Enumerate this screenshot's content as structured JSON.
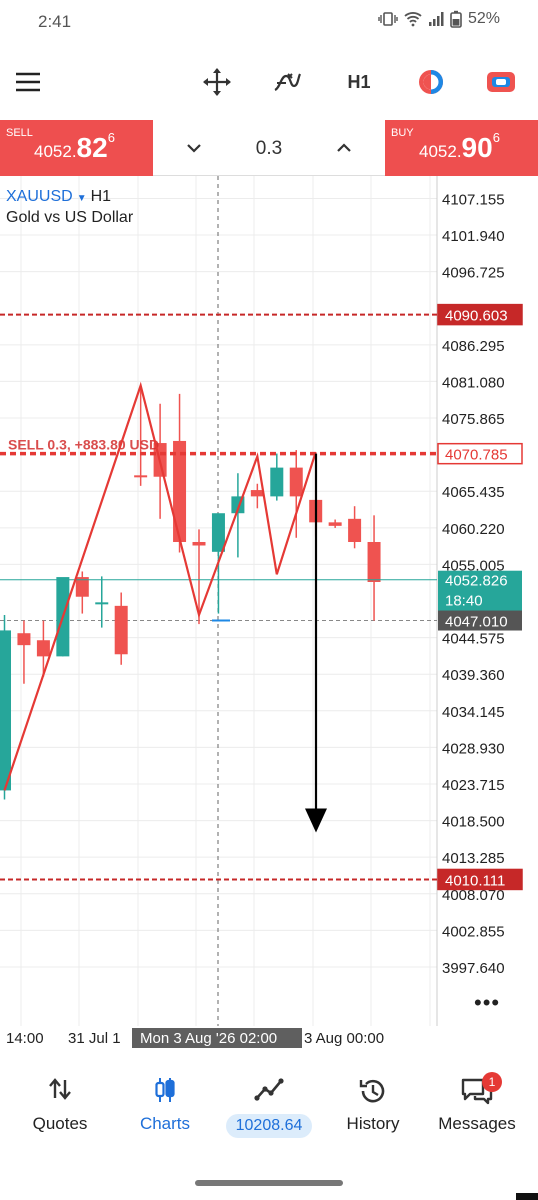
{
  "status": {
    "time": "2:41",
    "battery": "52%"
  },
  "toolbar": {
    "timeframe": "H1",
    "icons": [
      "menu-icon",
      "crosshair-icon",
      "indicator-icon",
      "timeframe",
      "color-icon",
      "oneclick-icon"
    ]
  },
  "trade": {
    "sell_label": "SELL",
    "sell_price_small": "4052.",
    "sell_price_big": "82",
    "sell_price_sup": "6",
    "buy_label": "BUY",
    "buy_price_small": "4052.",
    "buy_price_big": "90",
    "buy_price_sup": "6",
    "lot": "0.3"
  },
  "chart_header": {
    "symbol": "XAUUSD",
    "timeframe": "H1",
    "description": "Gold vs US Dollar"
  },
  "chart_data": {
    "type": "candlestick",
    "symbol": "XAUUSD",
    "timeframe": "H1",
    "ylim": [
      3994.5,
      4109.5
    ],
    "y_ticks": [
      4107.155,
      4101.94,
      4096.725,
      4086.295,
      4081.08,
      4075.865,
      4065.435,
      4060.22,
      4055.005,
      4044.575,
      4039.36,
      4034.145,
      4028.93,
      4023.715,
      4018.5,
      4013.285,
      4008.07,
      4002.855,
      3997.64
    ],
    "x_labels": [
      "14:00",
      "31 Jul 1",
      "Mon 3 Aug '26 02:00",
      "3 Aug 00:00"
    ],
    "candles": [
      {
        "o": 4022.8,
        "h": 4047.8,
        "l": 4021.5,
        "c": 4045.6
      },
      {
        "o": 4045.2,
        "h": 4047.0,
        "l": 4038.0,
        "c": 4043.5
      },
      {
        "o": 4044.2,
        "h": 4047.0,
        "l": 4039.0,
        "c": 4041.9
      },
      {
        "o": 4041.9,
        "h": 4051.0,
        "l": 4041.9,
        "c": 4053.2
      },
      {
        "o": 4053.2,
        "h": 4054.0,
        "l": 4048.0,
        "c": 4050.4
      },
      {
        "o": 4049.6,
        "h": 4053.3,
        "l": 4046.0,
        "c": 4049.6
      },
      {
        "o": 4049.1,
        "h": 4051.0,
        "l": 4040.7,
        "c": 4042.2
      },
      {
        "o": 4067.7,
        "h": 4080.5,
        "l": 4066.2,
        "c": 4067.5
      },
      {
        "o": 4072.3,
        "h": 4077.9,
        "l": 4061.5,
        "c": 4067.5
      },
      {
        "o": 4072.6,
        "h": 4079.3,
        "l": 4056.7,
        "c": 4058.2
      },
      {
        "o": 4058.2,
        "h": 4060.0,
        "l": 4046.5,
        "c": 4057.7
      },
      {
        "o": 4056.8,
        "h": 4061.9,
        "l": 4048.0,
        "c": 4062.3
      },
      {
        "o": 4062.3,
        "h": 4068.0,
        "l": 4056.0,
        "c": 4064.7
      },
      {
        "o": 4065.6,
        "h": 4066.5,
        "l": 4063.0,
        "c": 4064.7
      },
      {
        "o": 4064.7,
        "h": 4070.8,
        "l": 4064.1,
        "c": 4068.8
      },
      {
        "o": 4068.8,
        "h": 4071.3,
        "l": 4058.8,
        "c": 4064.7
      },
      {
        "o": 4064.2,
        "h": 4070.9,
        "l": 4059.0,
        "c": 4061.0
      },
      {
        "o": 4061.0,
        "h": 4061.4,
        "l": 4060.2,
        "c": 4060.5
      },
      {
        "o": 4061.5,
        "h": 4063.3,
        "l": 4057.3,
        "c": 4058.2
      },
      {
        "o": 4058.2,
        "h": 4062.0,
        "l": 4047.0,
        "c": 4052.5
      }
    ],
    "zigzag": [
      [
        0,
        4022.8
      ],
      [
        7,
        4080.5
      ],
      [
        10,
        4047.8
      ],
      [
        13,
        4070.4
      ],
      [
        14,
        4053.6
      ],
      [
        16,
        4071.0
      ]
    ],
    "down_arrow": {
      "from": 4070.8,
      "to": 4016.8
    },
    "levels": [
      {
        "price": 4090.603,
        "label": "4090.603",
        "style": "dashed",
        "color": "#c62828"
      },
      {
        "price": 4070.785,
        "label": "4070.785",
        "style": "dashed",
        "color": "#e53935"
      },
      {
        "price": 4010.111,
        "label": "4010.111",
        "style": "dashed",
        "color": "#c62828"
      }
    ],
    "bid": {
      "price": 4052.826,
      "label": "4052.826",
      "timer": "18:40",
      "color": "#26a69a"
    },
    "crosshair": {
      "price": 4047.01,
      "label": "4047.010"
    },
    "position_label": "SELL 0.3, +883.80 USD",
    "colors": {
      "bull": "#26a69a",
      "bear": "#ef5350",
      "zigzag": "#e53935",
      "arrow": "#000000"
    }
  },
  "nav": {
    "quotes": "Quotes",
    "charts": "Charts",
    "balance": "10208.64",
    "history": "History",
    "messages": "Messages",
    "messages_badge": "1"
  }
}
